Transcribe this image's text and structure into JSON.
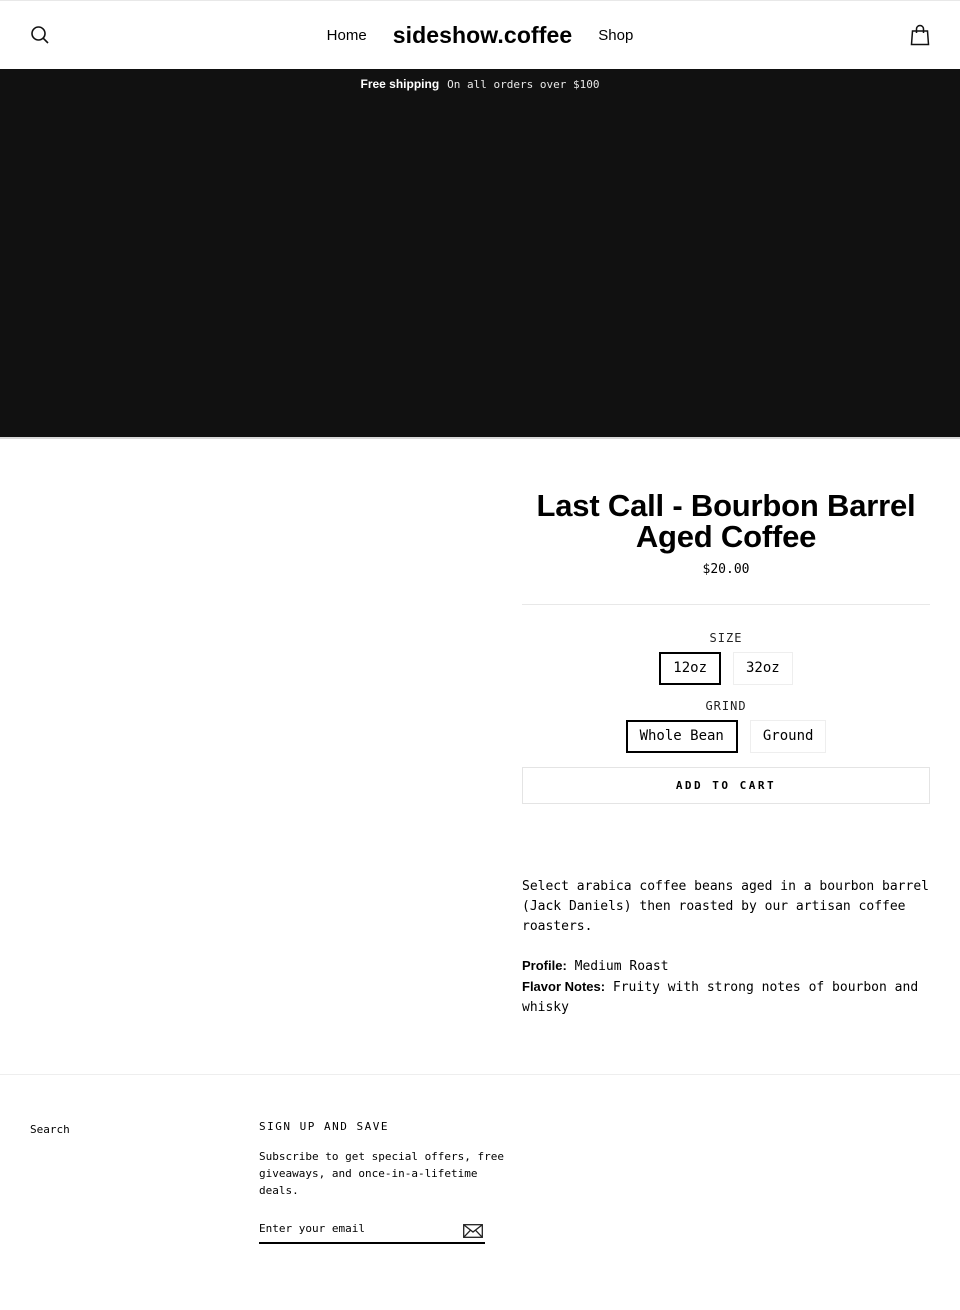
{
  "header": {
    "nav": {
      "home": "Home",
      "logo": "sideshow.coffee",
      "shop": "Shop"
    },
    "icons": {
      "search": "search-icon",
      "cart": "shopping-bag-icon"
    }
  },
  "announcement": {
    "bold": "Free shipping",
    "text": "On all orders over $100"
  },
  "product": {
    "title": "Last Call - Bourbon Barrel Aged Coffee",
    "price": "$20.00",
    "options": [
      {
        "label": "SIZE",
        "values": [
          "12oz",
          "32oz"
        ],
        "selected": "12oz"
      },
      {
        "label": "GRIND",
        "values": [
          "Whole Bean",
          "Ground"
        ],
        "selected": "Whole Bean"
      }
    ],
    "add_to_cart": "ADD TO CART",
    "description": "Select arabica coffee beans aged in a bourbon barrel (Jack Daniels) then roasted by our artisan coffee roasters.",
    "details": [
      {
        "key": "Profile:",
        "value": "Medium Roast"
      },
      {
        "key": "Flavor Notes:",
        "value": "Fruity with strong notes of bourbon and whisky"
      }
    ]
  },
  "footer": {
    "links": [
      "Search"
    ],
    "signup": {
      "heading": "SIGN UP AND SAVE",
      "blurb": "Subscribe to get special offers, free giveaways, and once-in-a-lifetime deals.",
      "email_placeholder": "Enter your email",
      "email_value": "",
      "submit_icon": "envelope-icon"
    }
  }
}
